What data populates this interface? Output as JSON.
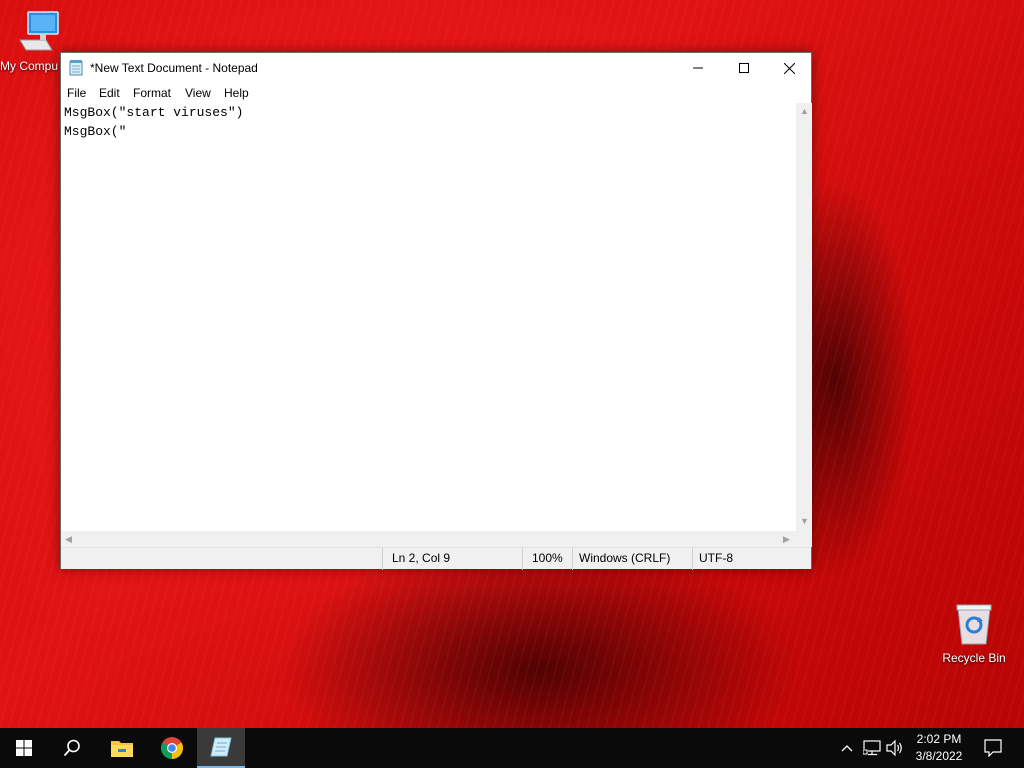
{
  "desktop": {
    "icons": [
      {
        "label": "My Compu"
      },
      {
        "label": "Recycle Bin"
      }
    ]
  },
  "notepad": {
    "title": "*New Text Document - Notepad",
    "menu": [
      "File",
      "Edit",
      "Format",
      "View",
      "Help"
    ],
    "lines": [
      "MsgBox(\"start viruses\")",
      "MsgBox(\""
    ],
    "status": {
      "position": "Ln 2, Col 9",
      "zoom": "100%",
      "line_ending": "Windows (CRLF)",
      "encoding": "UTF-8"
    }
  },
  "taskbar": {
    "apps": [
      "start-icon",
      "search-icon",
      "file-explorer-icon",
      "chrome-icon",
      "notepad-icon"
    ],
    "clock": {
      "time": "2:02 PM",
      "date": "3/8/2022"
    },
    "accent": "#76b9ed"
  },
  "colors": {
    "wallpaper": "#d40c0c",
    "taskbar": "#0a0a0a"
  }
}
